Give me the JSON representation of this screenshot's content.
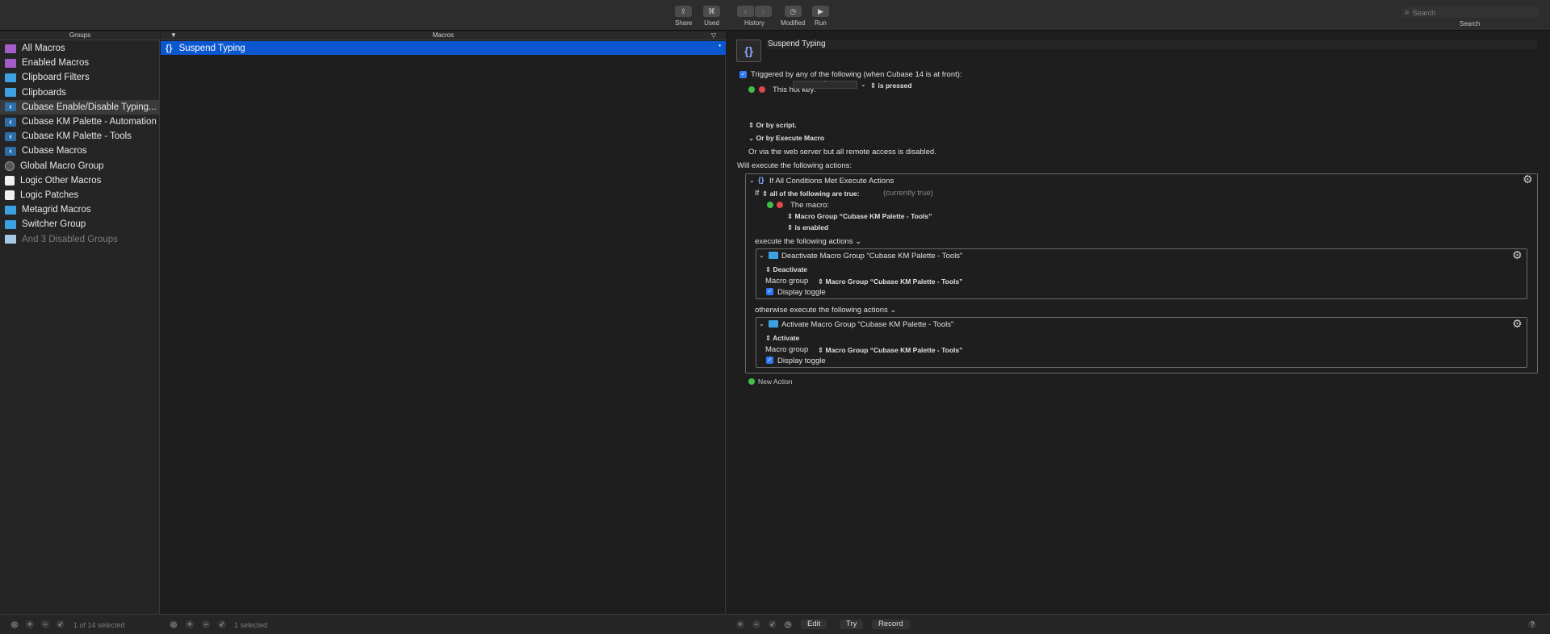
{
  "toolbar": {
    "share": "Share",
    "used": "Used",
    "history": "History",
    "modified": "Modified",
    "run": "Run",
    "search_placeholder": "Search",
    "search_label": "Search"
  },
  "columns": {
    "groups": "Groups",
    "macros": "Macros"
  },
  "groups": [
    {
      "label": "All Macros",
      "icon": "purple-folder-icon"
    },
    {
      "label": "Enabled Macros",
      "icon": "purple-folder-icon"
    },
    {
      "label": "Clipboard Filters",
      "icon": "blue-folder-icon"
    },
    {
      "label": "Clipboards",
      "icon": "blue-folder-icon"
    },
    {
      "label": "Cubase Enable/Disable Typing...",
      "icon": "palette-icon"
    },
    {
      "label": "Cubase KM Palette - Automation",
      "icon": "palette-icon"
    },
    {
      "label": "Cubase KM Palette - Tools",
      "icon": "palette-icon"
    },
    {
      "label": "Cubase Macros",
      "icon": "palette-icon"
    },
    {
      "label": "Global Macro Group",
      "icon": "globe-icon"
    },
    {
      "label": "Logic Other Macros",
      "icon": "white-square-icon"
    },
    {
      "label": "Logic Patches",
      "icon": "white-square-icon"
    },
    {
      "label": "Metagrid Macros",
      "icon": "blue-folder-icon"
    },
    {
      "label": "Switcher Group",
      "icon": "blue-folder-icon"
    },
    {
      "label": "And 3 Disabled Groups",
      "icon": "light-folder-icon"
    }
  ],
  "macros": [
    {
      "label": "Suspend Typing"
    }
  ],
  "editor": {
    "macro_name": "Suspend Typing",
    "trigger_header": "Triggered by any of the following (when Cubase 14 is at front):",
    "hotkey_label": "This hot key:",
    "hotkey_value": "`",
    "hotkey_condition": "is pressed",
    "or_by_script": "Or by script.",
    "or_by_execute": "Or by Execute Macro",
    "web_server_note": "Or via the web server but all remote access is disabled.",
    "will_execute": "Will execute the following actions:",
    "if_action_title": "If All Conditions Met Execute Actions",
    "if_label": "If",
    "if_condition": "all of the following are true:",
    "currently_true": "(currently true)",
    "the_macro_label": "The macro:",
    "macro_group_select": "Macro Group “Cubase KM Palette - Tools”",
    "is_enabled": "is enabled",
    "execute_following": "execute the following actions",
    "deactivate_title": "Deactivate Macro Group “Cubase KM Palette - Tools”",
    "deactivate_select": "Deactivate",
    "macro_group_label": "Macro group",
    "macro_group_value": "Macro Group “Cubase KM Palette - Tools”",
    "display_toggle": "Display toggle",
    "otherwise_execute": "otherwise execute the following actions",
    "activate_title": "Activate Macro Group “Cubase KM Palette - Tools”",
    "activate_select": "Activate",
    "macro_group_label2": "Macro group",
    "macro_group_value2": "Macro Group “Cubase KM Palette - Tools”",
    "display_toggle2": "Display toggle",
    "new_action": "New Action"
  },
  "bottombar": {
    "groups_status": "1 of 14 selected",
    "macros_status": "1 selected",
    "edit": "Edit",
    "try": "Try",
    "record": "Record",
    "help": "?"
  },
  "colors": {
    "selection_blue": "#0b57d0",
    "checkbox_blue": "#2f7cf6",
    "green_dot": "#3fbf4a",
    "red_dot": "#e0474c"
  }
}
